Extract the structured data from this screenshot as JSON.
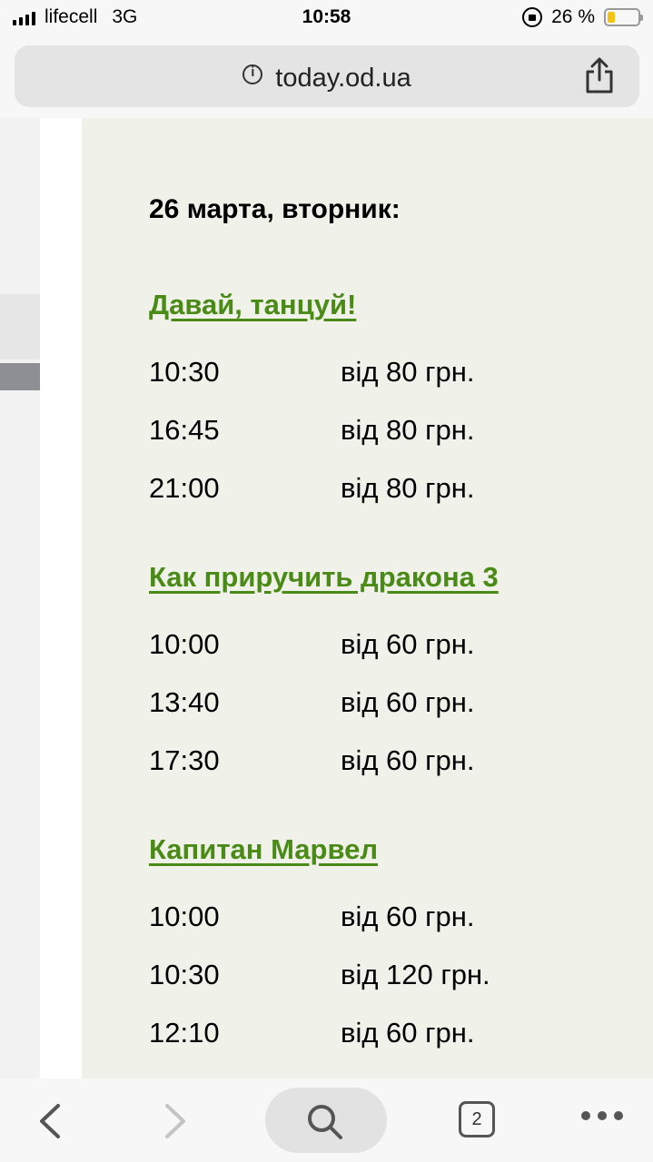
{
  "status_bar": {
    "carrier": "lifecell",
    "network": "3G",
    "time": "10:58",
    "battery_text": "26 %",
    "battery_level": 0.26
  },
  "browser": {
    "url": "today.od.ua",
    "open_tabs": "2"
  },
  "schedule": {
    "date_heading": "26 марта, вторник:",
    "films": [
      {
        "title": "Давай, танцуй!",
        "showings": [
          {
            "time": "10:30",
            "price": "від 80 грн."
          },
          {
            "time": "16:45",
            "price": "від 80 грн."
          },
          {
            "time": "21:00",
            "price": "від 80 грн."
          }
        ]
      },
      {
        "title": "Как приручить дракона 3",
        "showings": [
          {
            "time": "10:00",
            "price": "від 60 грн."
          },
          {
            "time": "13:40",
            "price": "від 60 грн."
          },
          {
            "time": "17:30",
            "price": "від 60 грн."
          }
        ]
      },
      {
        "title": "Капитан Марвел",
        "showings": [
          {
            "time": "10:00",
            "price": "від 60 грн."
          },
          {
            "time": "10:30",
            "price": "від 120 грн."
          },
          {
            "time": "12:10",
            "price": "від 60 грн."
          }
        ]
      }
    ]
  },
  "colors": {
    "link": "#4a8a16",
    "content_bg": "#f0f2ea",
    "battery": "#f3c316"
  }
}
